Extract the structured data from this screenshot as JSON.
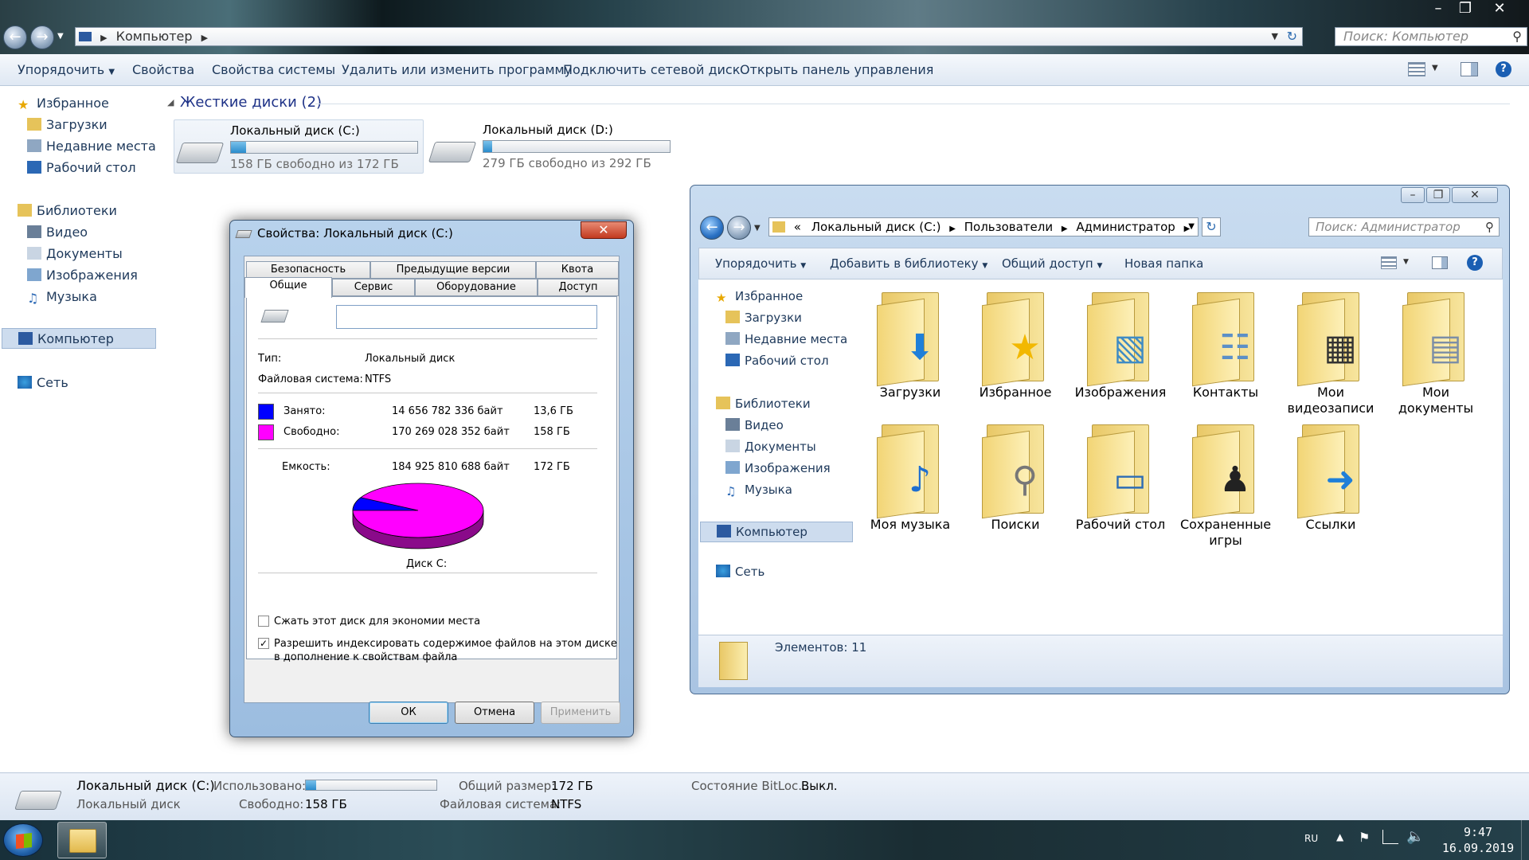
{
  "main": {
    "address": "Компьютер",
    "search_placeholder": "Поиск: Компьютер",
    "toolbar": {
      "organize": "Упорядочить",
      "properties": "Свойства",
      "system_properties": "Свойства системы",
      "uninstall": "Удалить или изменить программу",
      "map_drive": "Подключить сетевой диск",
      "control_panel": "Открыть панель управления"
    },
    "sidebar": {
      "favorites": "Избранное",
      "downloads": "Загрузки",
      "recent": "Недавние места",
      "desktop": "Рабочий стол",
      "libraries": "Библиотеки",
      "video": "Видео",
      "documents": "Документы",
      "images": "Изображения",
      "music": "Музыка",
      "computer": "Компьютер",
      "network": "Сеть"
    },
    "group_header": "Жесткие диски (2)",
    "drives": [
      {
        "name": "Локальный диск (C:)",
        "free": "158 ГБ свободно из 172 ГБ",
        "used_fraction": 0.08
      },
      {
        "name": "Локальный диск (D:)",
        "free": "279 ГБ свободно из 292 ГБ",
        "used_fraction": 0.045
      }
    ],
    "details": {
      "name": "Локальный диск (C:)",
      "type": "Локальный диск",
      "used_label": "Использовано:",
      "free_label": "Свободно:",
      "free_value": "158 ГБ",
      "total_label": "Общий размер:",
      "total_value": "172 ГБ",
      "fs_label": "Файловая система:",
      "fs_value": "NTFS",
      "bitlocker_label": "Состояние BitLoc...",
      "bitlocker_value": "Выкл."
    }
  },
  "dialog": {
    "title": "Свойства: Локальный диск (C:)",
    "tabs_top": [
      "Безопасность",
      "Предыдущие версии",
      "Квота"
    ],
    "tabs_bottom": [
      "Общие",
      "Сервис",
      "Оборудование",
      "Доступ"
    ],
    "name_value": "",
    "type_label": "Тип:",
    "type_value": "Локальный диск",
    "fs_label": "Файловая система:",
    "fs_value": "NTFS",
    "used_label": "Занято:",
    "used_bytes": "14 656 782 336 байт",
    "used_gb": "13,6 ГБ",
    "free_label": "Свободно:",
    "free_bytes": "170 269 028 352 байт",
    "free_gb": "158 ГБ",
    "capacity_label": "Емкость:",
    "capacity_bytes": "184 925 810 688 байт",
    "capacity_gb": "172 ГБ",
    "disk_label": "Диск C:",
    "compress_label": "Сжать этот диск для экономии места",
    "index_label_1": "Разрешить индексировать содержимое файлов на этом диске",
    "index_label_2": "в дополнение к свойствам файла",
    "ok": "ОК",
    "cancel": "Отмена",
    "apply": "Применить",
    "used_color": "#0000ff",
    "free_color": "#ff00ff"
  },
  "window2": {
    "breadcrumb_prefix": "«",
    "crumbs": [
      "Локальный диск (C:)",
      "Пользователи",
      "Администратор"
    ],
    "search_placeholder": "Поиск: Администратор",
    "toolbar": {
      "organize": "Упорядочить",
      "add_library": "Добавить в библиотеку",
      "share": "Общий доступ",
      "new_folder": "Новая папка"
    },
    "sidebar": {
      "favorites": "Избранное",
      "downloads": "Загрузки",
      "recent": "Недавние места",
      "desktop": "Рабочий стол",
      "libraries": "Библиотеки",
      "video": "Видео",
      "documents": "Документы",
      "images": "Изображения",
      "music": "Музыка",
      "computer": "Компьютер",
      "network": "Сеть"
    },
    "folders": [
      {
        "label": "Загрузки",
        "icon": "download-arrow-icon"
      },
      {
        "label": "Избранное",
        "icon": "star-icon"
      },
      {
        "label": "Изображения",
        "icon": "picture-icon"
      },
      {
        "label": "Контакты",
        "icon": "contact-card-icon"
      },
      {
        "label": "Мои видеозаписи",
        "icon": "film-icon"
      },
      {
        "label": "Мои документы",
        "icon": "document-icon"
      },
      {
        "label": "Моя музыка",
        "icon": "music-note-icon"
      },
      {
        "label": "Поиски",
        "icon": "magnifier-icon"
      },
      {
        "label": "Рабочий стол",
        "icon": "monitor-icon"
      },
      {
        "label": "Сохраненные игры",
        "icon": "chess-piece-icon"
      },
      {
        "label": "Ссылки",
        "icon": "link-arrow-icon"
      }
    ],
    "status": "Элементов: 11"
  },
  "taskbar": {
    "lang": "RU",
    "time": "9:47",
    "date": "16.09.2019"
  }
}
